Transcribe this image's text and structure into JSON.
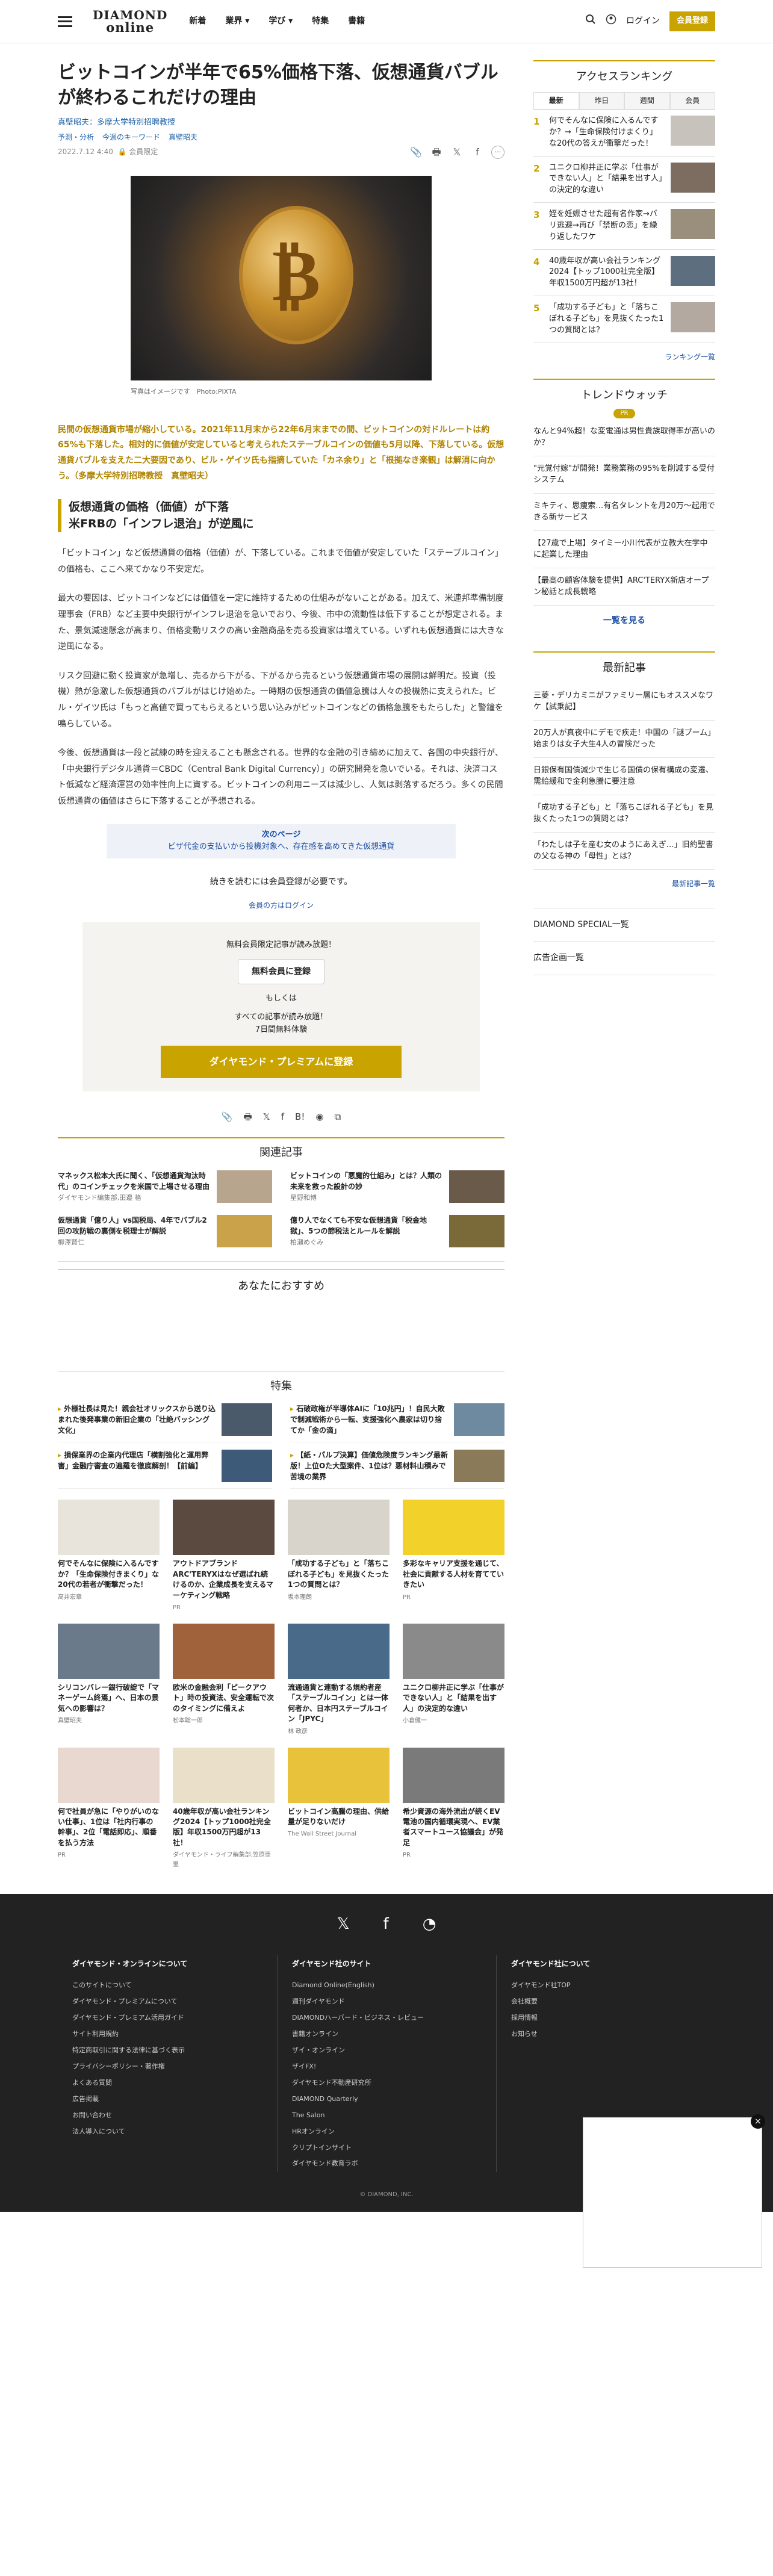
{
  "header": {
    "logo_line1": "DIAMOND",
    "logo_line2": "online",
    "nav": [
      "新着",
      "業界 ▾",
      "学び ▾",
      "特集",
      "書籍"
    ],
    "login": "ログイン",
    "register": "会員登録"
  },
  "article": {
    "title": "ビットコインが半年で65%価格下落、仮想通貨バブルが終わるこれだけの理由",
    "author": "真壁昭夫：多摩大学特別招聘教授",
    "tags": [
      "予測・分析",
      "今週のキーワード",
      "真壁昭夫"
    ],
    "date": "2022.7.12 4:40",
    "member_label": "会員限定",
    "photo_caption": "写真はイメージです　Photo:PIXTA",
    "lead": "民間の仮想通貨市場が縮小している。2021年11月末から22年6月末までの間、ビットコインの対ドルレートは約65%も下落した。相対的に価値が安定していると考えられたステーブルコインの価値も5月以降、下落している。仮想通貨バブルを支えた二大要因であり、ビル・ゲイツ氏も指摘していた「カネ余り」と「根拠なき楽観」は解消に向かう。（多摩大学特別招聘教授　真壁昭夫）",
    "h2_line1": "仮想通貨の価格（価値）が下落",
    "h2_line2": "米FRBの「インフレ退治」が逆風に",
    "paragraphs": [
      "「ビットコイン」など仮想通貨の価格（価値）が、下落している。これまで価値が安定していた「ステーブルコイン」の価格も、ここへ来てかなり不安定だ。",
      "最大の要因は、ビットコインなどには価値を一定に維持するための仕組みがないことがある。加えて、米連邦準備制度理事会（FRB）など主要中央銀行がインフレ退治を急いでおり、今後、市中の流動性は低下することが想定される。また、景気減速懸念が高まり、価格変動リスクの高い金融商品を売る投資家は増えている。いずれも仮想通貨には大きな逆風になる。",
      "リスク回避に動く投資家が急増し、売るから下がる、下がるから売るという仮想通貨市場の展開は鮮明だ。投資（投機）熱が急激した仮想通貨のバブルがはじけ始めた。一時期の仮想通貨の価値急騰は人々の投機熱に支えられた。ビル・ゲイツ氏は「もっと高値で買ってもらえるという思い込みがビットコインなどの価格急騰をもたらした」と警鐘を鳴らしている。",
      "今後、仮想通貨は一段と試練の時を迎えることも懸念される。世界的な金融の引き締めに加えて、各国の中央銀行が、「中央銀行デジタル通貨＝CBDC（Central Bank Digital Currency）」の研究開発を急いでいる。それは、決済コスト低減など経済運営の効率性向上に資する。ビットコインの利用ニーズは減少し、人気は剥落するだろう。多くの民間仮想通貨の価値はさらに下落することが予想される。"
    ],
    "next_page_label": "次のページ",
    "next_page_text": "ビザ代金の支払いから投機対象へ、存在感を高めてきた仮想通貨",
    "continue_text": "続きを読むには会員登録が必要です。",
    "login_link": "会員の方はログイン",
    "paywall": {
      "free_note": "無料会員限定記事が読み放題！",
      "free_button": "無料会員に登録",
      "or": "もしくは",
      "all_note1": "すべての記事が読み放題！",
      "all_note2": "7日間無料体験",
      "premium_button": "ダイヤモンド・プレミアムに登録"
    }
  },
  "related": {
    "title": "関連記事",
    "items": [
      {
        "title": "マネックス松本大氏に聞く、「仮想通貨淘汰時代」のコインチェックを米国で上場させる理由",
        "source": "ダイヤモンド編集部,田邉 格"
      },
      {
        "title": "ビットコインの「悪魔的仕組み」とは？人類の未来を救った設計の妙",
        "source": "星野和博"
      },
      {
        "title": "仮想通貨「億り人」vs国税局、4年でバブル2回の攻防戦の裏側を税理士が解説",
        "source": "柳澤賢仁"
      },
      {
        "title": "億り人でなくても不安な仮想通貨「税金地獄」、5つの節税法とルールを解説",
        "source": "柏瀬めぐみ"
      }
    ]
  },
  "recommend_title": "あなたにおすすめ",
  "feature": {
    "title": "特集",
    "items": [
      "外様社長は見た！親会社オリックスから送り込まれた後発事業の新旧企業の「壮絶バッシング文化」",
      "石破政権が半導体AIに「10兆円」！自民大敗で制減戦術から一転、支援強化へ農家は切り捨てか「金の滴」",
      "損保業界の企業内代理店「横割強化と運用弊害」金融庁審査の遍羅を徹底解剖！【前編】",
      "【紙・パルプ決算】価値危険度ランキング最新版！上位Oた大型案件、1位は？悪材料山積みで苦境の業界"
    ]
  },
  "cards": [
    {
      "title": "何でそんなに保険に入るんですか？「生命保険付きまくり」な20代の若者が衝撃だった！",
      "source": "高井宏章"
    },
    {
      "title": "アウトドアブランドARC'TERYXはなぜ選ばれ続けるのか、企業成長を支えるマーケティング戦略",
      "source": "PR"
    },
    {
      "title": "「成功する子ども」と「落ちこぼれる子ども」を見抜くたった1つの質問とは？",
      "source": "坂本理朗"
    },
    {
      "title": "多彩なキャリア支援を通じて、社会に貢献する人材を育てていきたい",
      "source": "PR"
    },
    {
      "title": "シリコンバレー銀行破綻で「マネーゲーム終焉」へ、日本の景気への影響は？",
      "source": "真壁昭夫"
    },
    {
      "title": "欧米の金融会利「ピークアウト」時の投資法、安全運転で次のタイミングに備えよ",
      "source": "松本聡一郎"
    },
    {
      "title": "流通通貨と連動する規約者産「ステーブルコイン」とは一体何者か、日本円ステーブルコイン「JPYC」",
      "source": "林 政彦"
    },
    {
      "title": "ユニクロ柳井正に学ぶ「仕事ができない人」と「結果を出す人」の決定的な違い",
      "source": "小倉健一"
    },
    {
      "title": "何で社員が急に「やりがいのない仕事」、1位は「社内行事の幹事」、2位「電話即応」、順番を払う方法",
      "source": "PR"
    },
    {
      "title": "40歳年収が高い会社ランキング2024【トップ1000社完全版】年収1500万円超が13社！",
      "source": "ダイヤモンド・ライフ編集部,笠原亜里"
    },
    {
      "title": "ビットコイン高騰の理由、供給量が足りないだけ",
      "source": "The Wall Street Journal"
    },
    {
      "title": "希少資源の海外流出が続くEV電池の国内循環実現へ、EV業者スマートユース協議会」が発足",
      "source": "PR"
    }
  ],
  "sidebar": {
    "ranking_title": "アクセスランキング",
    "ranking_tabs": [
      "最新",
      "昨日",
      "週間",
      "会員"
    ],
    "ranking": [
      {
        "rank": "1",
        "title": "何でそんなに保険に入るんですか？→「生命保険付けまくり」な20代の答えが衝撃だった！"
      },
      {
        "rank": "2",
        "title": "ユニクロ柳井正に学ぶ「仕事ができない人」と「結果を出す人」の決定的な違い"
      },
      {
        "rank": "3",
        "title": "姪を妊娠させた超有名作家→パリ逃避→再び「禁断の恋」を繰り返したワケ"
      },
      {
        "rank": "4",
        "title": "40歳年収が高い会社ランキング2024【トップ1000社完全版】年収1500万円超が13社！"
      },
      {
        "rank": "5",
        "title": "「成功する子ども」と「落ちこぼれる子ども」を見抜くたった1つの質問とは？"
      }
    ],
    "ranking_more": "ランキング一覧",
    "trend_title": "トレンドウォッチ",
    "trend_badge": "PR",
    "trends": [
      "なんと94%超！な変電通は男性貴族取得率が高いのか？",
      "\"元覚付嫁\"が開発！業務業務の95%を削減する受付システム",
      "ミキティ、思痩索…有名タレントを月20万〜起用できる新サービス",
      "【27歳で上場】タイミー小川代表が立教大在学中に起業した理由",
      "【最高の顧客体験を提供】ARC'TERYX新店オープン秘話と成長戦略"
    ],
    "trend_more": "一覧を見る",
    "latest_title": "最新記事",
    "latest": [
      "三菱・デリカミニがファミリー層にもオススメなワケ【試乗記】",
      "20万人が真夜中にデモで疾走！中国の「謎ブーム」始まりは女子大生4人の冒険だった",
      "日銀保有国債減少で生じる国債の保有構成の変遷、需給緩和で金利急騰に要注意",
      "「成功する子ども」と「落ちこぼれる子ども」を見抜くたった1つの質問とは？",
      "「わたしは子を産む女のようにあえぎ…」旧約聖書の父なる神の「母性」とは？"
    ],
    "latest_more": "最新記事一覧",
    "special": "DIAMOND SPECIAL一覧",
    "ad_list": "広告企画一覧"
  },
  "footer": {
    "cols": [
      {
        "title": "ダイヤモンド・オンラインについて",
        "links": [
          "このサイトについて",
          "ダイヤモンド・プレミアムについて",
          "ダイヤモンド・プレミアム活用ガイド",
          "サイト利用規約",
          "特定商取引に関する法律に基づく表示",
          "プライバシーポリシー・著作権",
          "よくある質問",
          "広告掲載",
          "お問い合わせ",
          "法人導入について"
        ]
      },
      {
        "title": "ダイヤモンド社のサイト",
        "links": [
          "Diamond Online(English)",
          "週刊ダイヤモンド",
          "DIAMONDハーバード・ビジネス・レビュー",
          "書籍オンライン",
          "ザイ・オンライン",
          "ザイFX!",
          "ダイヤモンド不動産研究所",
          "DIAMOND Quarterly",
          "The Salon",
          "HRオンライン",
          "クリプトインサイト",
          "ダイヤモンド教育ラボ"
        ]
      },
      {
        "title": "ダイヤモンド社について",
        "links": [
          "ダイヤモンド社TOP",
          "会社概要",
          "採用情報",
          "お知らせ"
        ]
      }
    ],
    "copyright": "© DIAMOND, INC."
  }
}
